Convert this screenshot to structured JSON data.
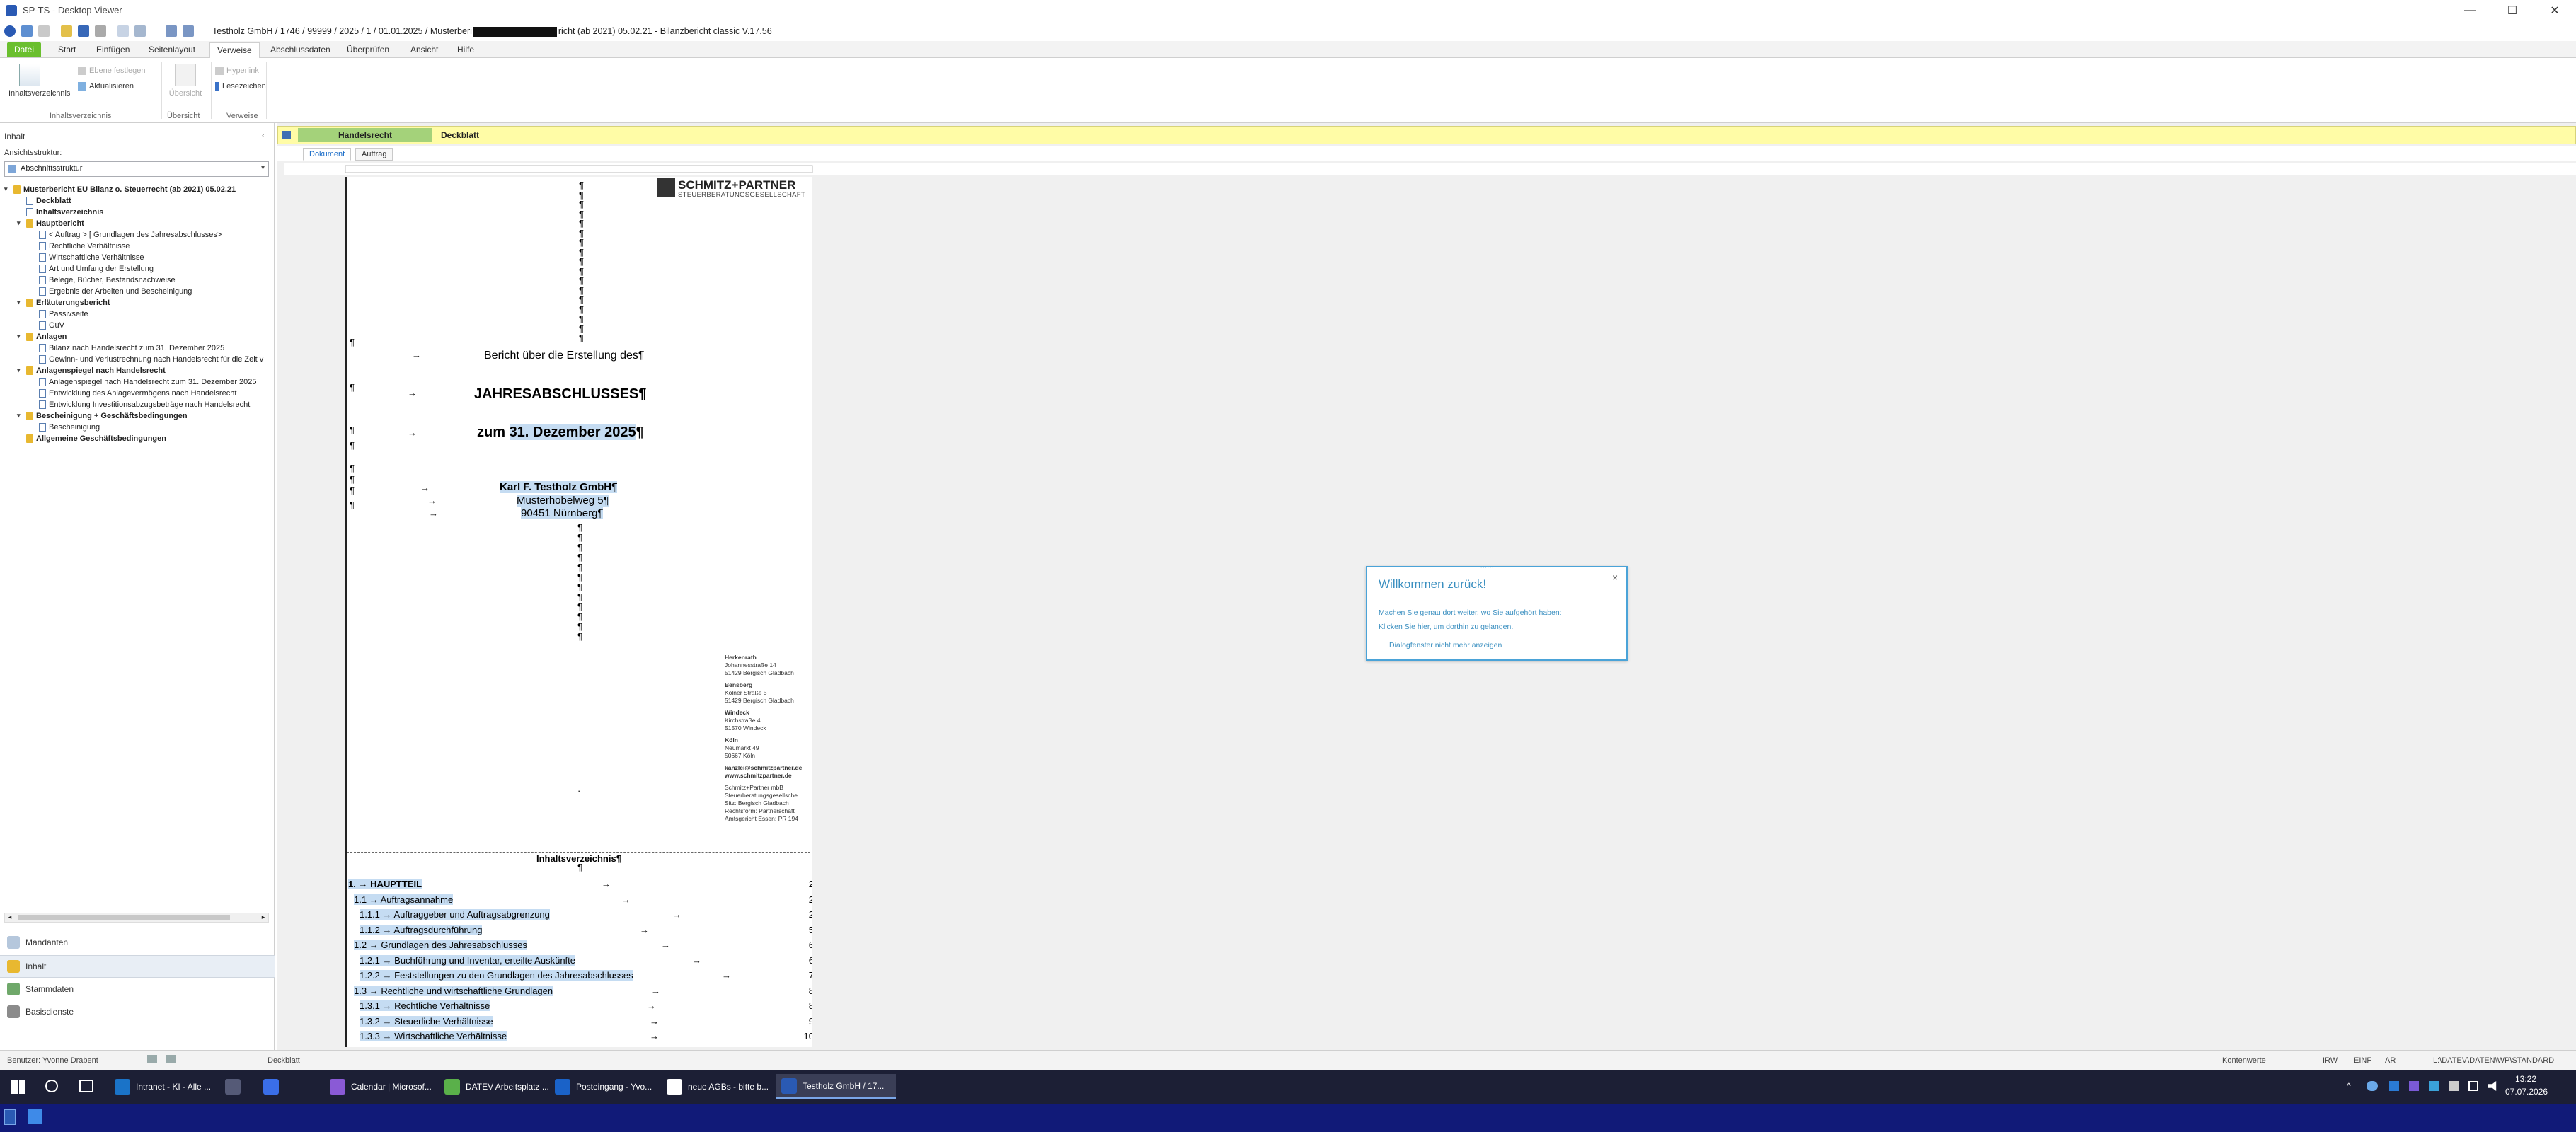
{
  "window": {
    "title": "SP-TS - Desktop Viewer",
    "minimize": "—",
    "maximize": "☐",
    "close": "✕"
  },
  "quickaccess": {
    "document_title": "Testholz GmbH / 1746 / 99999 / 2025 / 1 / 01.01.2025 / Musterberi",
    "document_title_rest": "richt (ab 2021) 05.02.21 - Bilanzbericht classic V.17.56"
  },
  "ribbon_tabs": [
    "Datei",
    "Start",
    "Einfügen",
    "Seitenlayout",
    "Verweise",
    "Abschlussdaten",
    "Überprüfen",
    "Ansicht",
    "Hilfe"
  ],
  "ribbon": {
    "inhaltsverzeichnis": "Inhaltsverzeichnis",
    "ebene_festlegen": "Ebene festlegen",
    "aktualisieren": "Aktualisieren",
    "group_inhaltsverzeichnis": "Inhaltsverzeichnis",
    "uebersicht_btn": "Übersicht",
    "group_uebersicht": "Übersicht",
    "hyperlink": "Hyperlink",
    "lesezeichen": "Lesezeichen",
    "group_verweise": "Verweise"
  },
  "leftpanel": {
    "header": "Inhalt",
    "ansicht_label": "Ansichtsstruktur:",
    "ansicht_value": "Abschnittsstruktur",
    "tree": [
      {
        "label": "Musterbericht EU Bilanz o. Steuerrecht (ab 2021) 05.02.21",
        "level": 0,
        "bold": true,
        "icon": "folder",
        "exp": "▾"
      },
      {
        "label": "Deckblatt",
        "level": 1,
        "bold": true,
        "icon": "page",
        "exp": ""
      },
      {
        "label": "Inhaltsverzeichnis",
        "level": 1,
        "bold": true,
        "icon": "page",
        "exp": ""
      },
      {
        "label": "Hauptbericht",
        "level": 1,
        "bold": true,
        "icon": "folder",
        "exp": "▾"
      },
      {
        "label": "< Auftrag > [ Grundlagen des Jahresabschlusses>",
        "level": 2,
        "bold": false,
        "icon": "page",
        "exp": ""
      },
      {
        "label": "Rechtliche Verhältnisse",
        "level": 2,
        "bold": false,
        "icon": "page",
        "exp": ""
      },
      {
        "label": "Wirtschaftliche Verhältnisse",
        "level": 2,
        "bold": false,
        "icon": "page",
        "exp": ""
      },
      {
        "label": "Art und Umfang der Erstellung",
        "level": 2,
        "bold": false,
        "icon": "page",
        "exp": ""
      },
      {
        "label": "Belege, Bücher, Bestandsnachweise",
        "level": 2,
        "bold": false,
        "icon": "page",
        "exp": ""
      },
      {
        "label": "Ergebnis der Arbeiten und Bescheinigung",
        "level": 2,
        "bold": false,
        "icon": "page",
        "exp": ""
      },
      {
        "label": "Erläuterungsbericht",
        "level": 1,
        "bold": true,
        "icon": "folder",
        "exp": "▾"
      },
      {
        "label": "Passivseite",
        "level": 2,
        "bold": false,
        "icon": "page",
        "exp": ""
      },
      {
        "label": "GuV",
        "level": 2,
        "bold": false,
        "icon": "page",
        "exp": ""
      },
      {
        "label": "Anlagen",
        "level": 1,
        "bold": true,
        "icon": "folder",
        "exp": "▾"
      },
      {
        "label": "Bilanz nach Handelsrecht zum 31. Dezember 2025",
        "level": 2,
        "bold": false,
        "icon": "page",
        "exp": ""
      },
      {
        "label": "Gewinn- und Verlustrechnung nach Handelsrecht für die Zeit v",
        "level": 2,
        "bold": false,
        "icon": "page",
        "exp": ""
      },
      {
        "label": "Anlagenspiegel nach Handelsrecht",
        "level": 1,
        "bold": true,
        "icon": "folder",
        "exp": "▾"
      },
      {
        "label": "Anlagenspiegel nach Handelsrecht zum 31. Dezember 2025",
        "level": 2,
        "bold": false,
        "icon": "page",
        "exp": ""
      },
      {
        "label": "Entwicklung des Anlagevermögens nach Handelsrecht",
        "level": 2,
        "bold": false,
        "icon": "page",
        "exp": ""
      },
      {
        "label": "Entwicklung Investitionsabzugsbeträge nach Handelsrecht",
        "level": 2,
        "bold": false,
        "icon": "page",
        "exp": ""
      },
      {
        "label": "Bescheinigung + Geschäftsbedingungen",
        "level": 1,
        "bold": true,
        "icon": "folder",
        "exp": "▾"
      },
      {
        "label": "Bescheinigung",
        "level": 2,
        "bold": false,
        "icon": "page",
        "exp": ""
      },
      {
        "label": "Allgemeine Geschäftsbedingungen",
        "level": 1,
        "bold": true,
        "icon": "folder",
        "exp": ""
      }
    ],
    "nav": [
      "Mandanten",
      "Inhalt",
      "Stammdaten",
      "Basisdienste"
    ]
  },
  "doc": {
    "yellow_tabs": [
      "Handelsrecht",
      "Deckblatt"
    ],
    "subtabs": [
      "Dokument",
      "Auftrag"
    ],
    "logo_name": "SCHMITZ+PARTNER",
    "logo_sub": "STEUERBERATUNGSGESELLSCHAFT",
    "line1": "Bericht über die Erstellung des¶",
    "line2": "JAHRESABSCHLUSSES¶",
    "line3a": "zum ",
    "line3b": "31. Dezember 2025",
    "line3c": "¶",
    "company": "Karl F. Testholz GmbH¶",
    "street": "Musterhobelweg 5¶",
    "city": "90451 Nürnberg¶",
    "addresses": [
      {
        "head": "Herkenrath",
        "l1": "Johannesstraße 14",
        "l2": "51429 Bergisch Gladbach"
      },
      {
        "head": "Bensberg",
        "l1": "Kölner Straße 5",
        "l2": "51429 Bergisch Gladbach"
      },
      {
        "head": "Windeck",
        "l1": "Kirchstraße 4",
        "l2": "51570 Windeck"
      },
      {
        "head": "Köln",
        "l1": "Neumarkt 49",
        "l2": "50667 Köln"
      }
    ],
    "email": "kanzlei@schmitzpartner.de",
    "web": "www.schmitzpartner.de",
    "legal1": "Schmitz+Partner mbB",
    "legal2": "Steuerberatungsgesellsche",
    "legal3": "Sitz: Bergisch Gladbach",
    "legal4": "Rechtsform: Partnerschaft",
    "legal5": "Amtsgericht Essen: PR 194",
    "toc_title": "Inhaltsverzeichnis¶",
    "toc": [
      {
        "num": "1.",
        "text": "HAUPTTEIL",
        "page": "2",
        "indent": 0
      },
      {
        "num": "1.1",
        "text": "Auftragsannahme",
        "page": "2",
        "indent": 1
      },
      {
        "num": "1.1.1",
        "text": "Auftraggeber und Auftragsabgrenzung",
        "page": "2",
        "indent": 2
      },
      {
        "num": "1.1.2",
        "text": "Auftragsdurchführung",
        "page": "5",
        "indent": 2
      },
      {
        "num": "1.2",
        "text": "Grundlagen des Jahresabschlusses",
        "page": "6",
        "indent": 1
      },
      {
        "num": "1.2.1",
        "text": "Buchführung und Inventar, erteilte Auskünfte",
        "page": "6",
        "indent": 2
      },
      {
        "num": "1.2.2",
        "text": "Feststellungen zu den Grundlagen des Jahresabschlusses",
        "page": "7",
        "indent": 2
      },
      {
        "num": "1.3",
        "text": "Rechtliche und wirtschaftliche Grundlagen",
        "page": "8",
        "indent": 1
      },
      {
        "num": "1.3.1",
        "text": "Rechtliche Verhältnisse",
        "page": "8",
        "indent": 2
      },
      {
        "num": "1.3.2",
        "text": "Steuerliche Verhältnisse",
        "page": "9",
        "indent": 2
      },
      {
        "num": "1.3.3",
        "text": "Wirtschaftliche Verhältnisse",
        "page": "10",
        "indent": 2
      }
    ]
  },
  "popup": {
    "title": "Willkommen zurück!",
    "text1": "Machen Sie genau dort weiter, wo Sie aufgehört haben:",
    "text2": "Klicken Sie hier, um dorthin zu gelangen.",
    "checkbox": "Dialogfenster nicht mehr anzeigen"
  },
  "statusbar": {
    "user": "Benutzer: Yvonne Drabent",
    "section": "Deckblatt",
    "kontenwerte": "Kontenwerte",
    "irw": "IRW",
    "einf": "EINF",
    "ar": "AR",
    "path": "L:\\DATEV\\DATEN\\WP\\STANDARD"
  },
  "taskbar": {
    "items": [
      {
        "label": "Intranet - KI - Alle ...",
        "color": "#1a73c8"
      },
      {
        "label": "",
        "color": "#555a77"
      },
      {
        "label": "",
        "color": "#3a6ee8"
      },
      {
        "label": "Calendar | Microsof...",
        "color": "#8a5ad6"
      },
      {
        "label": "DATEV Arbeitsplatz ...",
        "color": "#5ab04a"
      },
      {
        "label": "Posteingang - Yvo...",
        "color": "#1a62c8"
      },
      {
        "label": "neue AGBs - bitte b...",
        "color": "#ffffff"
      },
      {
        "label": "Testholz GmbH / 17...",
        "color": "#2a5ab4"
      }
    ],
    "time": "13:22",
    "date": "07.07.2026"
  }
}
